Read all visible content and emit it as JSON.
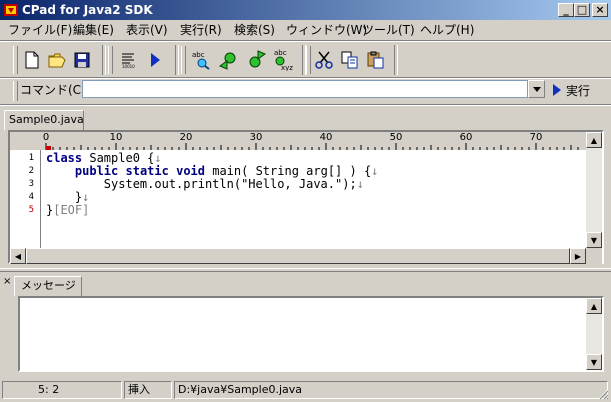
{
  "window": {
    "title": "CPad for Java2 SDK",
    "controls": {
      "minimize": "_",
      "maximize": "□",
      "close": "×"
    }
  },
  "menu": {
    "items": [
      "ファイル(F)",
      "編集(E)",
      "表示(V)",
      "実行(R)",
      "検索(S)",
      "ウィンドウ(W)",
      "ツール(T)",
      "ヘルプ(H)"
    ]
  },
  "toolbar": {
    "icons": [
      "new-file-icon",
      "open-folder-icon",
      "save-disk-icon",
      "compile-icon",
      "run-arrow-icon",
      "find-icon",
      "find-prev-icon",
      "find-next-icon",
      "replace-icon",
      "cut-scissors-icon",
      "copy-icon",
      "paste-icon"
    ]
  },
  "command": {
    "label": "コマンド(C)",
    "value": "",
    "run_label": "実行"
  },
  "editor": {
    "tab_label": "Sample0.java",
    "ruler_ticks": [
      "0",
      "10",
      "20",
      "30",
      "40",
      "50",
      "60",
      "70"
    ],
    "lines": [
      {
        "num": "1",
        "text": "class Sample0 {↓"
      },
      {
        "num": "2",
        "text": "    public static void main( String arg[] ) {↓"
      },
      {
        "num": "3",
        "text": "        System.out.println(\"Hello, Java.\");↓"
      },
      {
        "num": "4",
        "text": "    }↓"
      },
      {
        "num": "5",
        "text": "}[EOF]"
      }
    ]
  },
  "messages": {
    "tab_label": "メッセージ",
    "close_glyph": "×",
    "content": ""
  },
  "status": {
    "position": "5:  2",
    "mode": "挿入",
    "path": "D:¥java¥Sample0.java"
  },
  "colors": {
    "titlebar_start": "#0a246a",
    "titlebar_end": "#a6caf0",
    "keyword": "#000080",
    "face": "#d4d0c8"
  }
}
